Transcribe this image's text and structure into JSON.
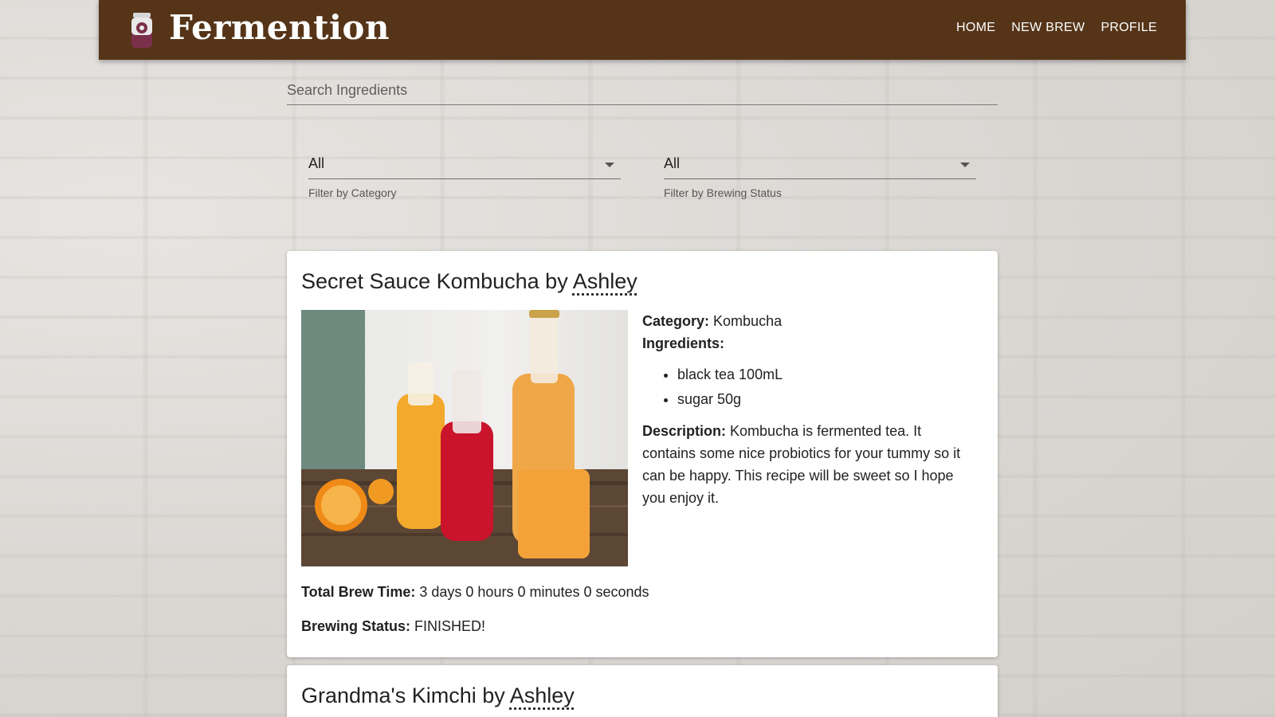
{
  "header": {
    "brand": "Fermention",
    "nav": [
      "HOME",
      "NEW BREW",
      "PROFILE"
    ],
    "colors": {
      "appbar": "#553418",
      "logo_lid": "#d8d8d8",
      "logo_jar": "#7a2f4a"
    }
  },
  "search": {
    "placeholder": "Search Ingredients"
  },
  "filters": {
    "category": {
      "value": "All",
      "helper": "Filter by Category"
    },
    "status": {
      "value": "All",
      "helper": "Filter by Brewing Status"
    }
  },
  "brews": [
    {
      "title": "Secret Sauce Kombucha by",
      "author": "Ashley",
      "category_label": "Category:",
      "category": "Kombucha",
      "ingredients_label": "Ingredients:",
      "ingredients": [
        "black tea 100mL",
        "sugar 50g"
      ],
      "description_label": "Description:",
      "description": "Kombucha is fermented tea. It contains some nice probiotics for your tummy so it can be happy. This recipe will be sweet so I hope you enjoy it.",
      "brew_time_label": "Total Brew Time:",
      "brew_time": "3 days 0 hours 0 minutes 0 seconds",
      "status_label": "Brewing Status:",
      "status": "FINISHED!"
    },
    {
      "title": "Grandma's Kimchi by",
      "author": "Ashley"
    }
  ]
}
